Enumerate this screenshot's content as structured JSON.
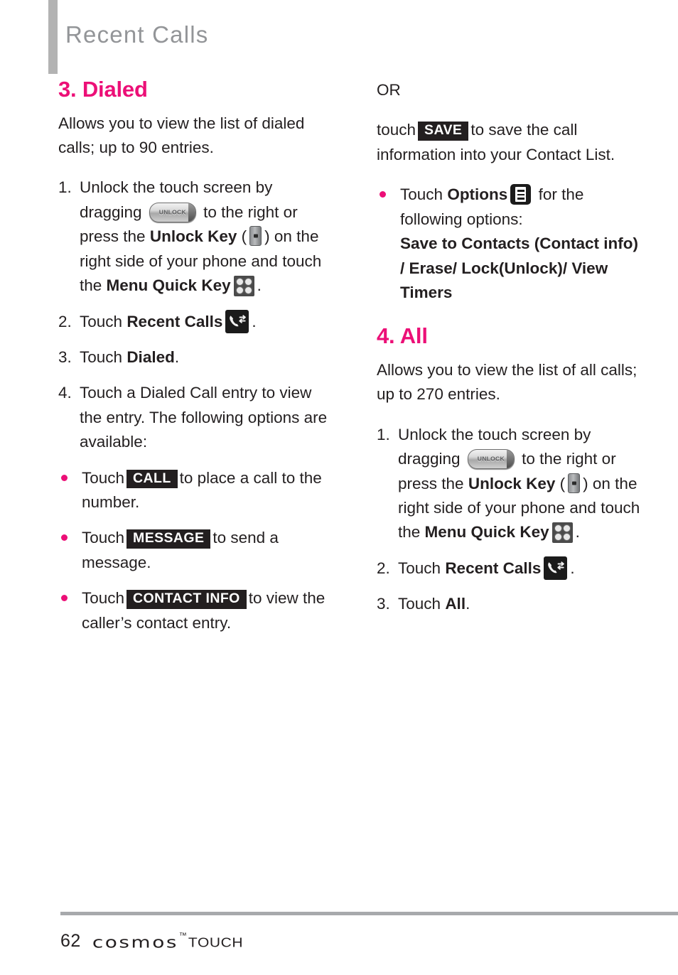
{
  "header": {
    "title": "Recent Calls",
    "bar_color": "#b3b3b3",
    "title_color": "#939598"
  },
  "theme": {
    "accent": "#ec0f77",
    "text": "#231f20",
    "badge_bg": "#231f20",
    "badge_text": "#ffffff"
  },
  "left_column": {
    "section": {
      "number": "3.",
      "title": "3. Dialed",
      "intro": "Allows you to view the list of dialed calls; up to 90 entries."
    },
    "steps": [
      {
        "num": "1.",
        "part1": "Unlock the touch screen by dragging",
        "icon1": "unlock-slider-icon",
        "part2": "to the right or press the",
        "bold1": "Unlock Key",
        "paren_open": "(",
        "icon2": "unlock-key-icon",
        "paren_close": ")",
        "part3": "on the right side of your phone and touch the",
        "bold2": "Menu Quick Key",
        "icon3": "menu-quick-key-icon",
        "part4": "."
      },
      {
        "num": "2.",
        "part1": "Touch",
        "bold1": "Recent Calls",
        "icon1": "recent-calls-icon",
        "part2": "."
      },
      {
        "num": "3.",
        "part1": "Touch",
        "bold1": "Dialed",
        "part2": "."
      },
      {
        "num": "4.",
        "part1": "Touch a Dialed Call entry to view the entry. The following options are available:"
      }
    ],
    "bullets": [
      {
        "pre": "Touch",
        "badge": "CALL",
        "post": "to place a call to the number."
      },
      {
        "pre": "Touch",
        "badge": "MESSAGE",
        "post": "to send a message."
      },
      {
        "pre": "Touch",
        "badge": "CONTACT INFO",
        "post": "to view the caller’s contact entry."
      }
    ]
  },
  "right_column": {
    "or_label": "OR",
    "save_paragraph": {
      "pre": "touch",
      "badge": "SAVE",
      "post": "to save the call information into your Contact List."
    },
    "options_bullet": {
      "pre": "Touch",
      "bold": "Options",
      "icon": "options-icon",
      "post": "for the following options:",
      "options_list": "Save to Contacts (Contact info) / Erase/ Lock(Unlock)/ View Timers"
    },
    "section": {
      "number": "4.",
      "title": "4. All",
      "intro": "Allows you to view the list of all calls; up to 270 entries."
    },
    "steps": [
      {
        "num": "1.",
        "part1": "Unlock the touch screen by dragging",
        "icon1": "unlock-slider-icon",
        "part2": "to the right or press the",
        "bold1": "Unlock Key",
        "paren_open": "(",
        "icon2": "unlock-key-icon",
        "paren_close": ")",
        "part3": "on the right side of your phone and touch the",
        "bold2": "Menu Quick Key",
        "icon3": "menu-quick-key-icon",
        "part4": "."
      },
      {
        "num": "2.",
        "part1": "Touch",
        "bold1": "Recent Calls",
        "icon1": "recent-calls-icon",
        "part2": "."
      },
      {
        "num": "3.",
        "part1": "Touch",
        "bold1": "All",
        "part2": "."
      }
    ]
  },
  "icons": {
    "unlock_slider_label": "UNLOCK"
  },
  "footer": {
    "page_number": "62",
    "brand": "cosmos",
    "trademark": "™",
    "brand_suffix": "TOUCH"
  }
}
